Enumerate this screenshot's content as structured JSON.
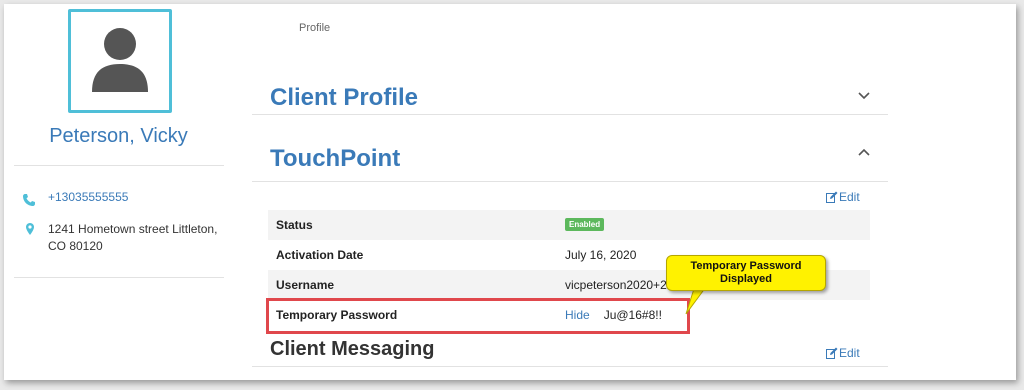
{
  "sidebar": {
    "client_name": "Peterson, Vicky",
    "phone": "+13035555555",
    "address": "1241 Hometown street Littleton, CO 80120"
  },
  "breadcrumb": "Profile",
  "sections": {
    "client_profile": {
      "title": "Client Profile"
    },
    "touchpoint": {
      "title": "TouchPoint",
      "edit_label": "Edit",
      "rows": {
        "status": {
          "label": "Status",
          "value": "Enabled"
        },
        "activation_date": {
          "label": "Activation Date",
          "value": "July 16, 2020"
        },
        "username": {
          "label": "Username",
          "value": "vicpeterson2020+2"
        },
        "temp_password": {
          "label": "Temporary Password",
          "hide_label": "Hide",
          "value": "Ju@16#8!!"
        }
      }
    },
    "client_messaging": {
      "title": "Client Messaging",
      "edit_label": "Edit"
    }
  },
  "annotation": {
    "callout_text": "Temporary Password Displayed"
  },
  "colors": {
    "accent": "#3a7ab8",
    "avatar_border": "#4fbfd8",
    "enabled_badge": "#5cb85c",
    "highlight_box": "#e0474c",
    "callout": "#fff200"
  }
}
